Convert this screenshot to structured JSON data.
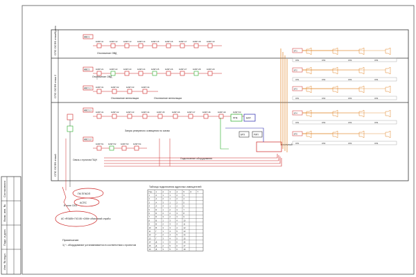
{
  "diagram": {
    "rows": [
      {
        "label": "СПС ОСФ5 этаж/Кухня"
      },
      {
        "label": "СПС ОСФ5 этаж 2"
      },
      {
        "label": "СПС ОСФ5 этаж1"
      }
    ],
    "panels": [
      "АВС1",
      "АВС1",
      "АВС1.1",
      "АВС1.1",
      "АВС1.2"
    ],
    "chain_row1": [
      "1МКП 11",
      "1МКП 12",
      "1МКП 13",
      "1МКП 14",
      "1МКП 15",
      "1МКП 16",
      "1МКП 17",
      "1МКП 18",
      "1МКП 19"
    ],
    "chain_row2": [
      "1МКП 21",
      "1МКП 22",
      "1МКП 23",
      "1МКП 24",
      "1МКП 25",
      "1МКП 26",
      "1МКП 27",
      "1МКП 28",
      "1МКП 29"
    ],
    "chain_row2b": [
      "1МКП 31",
      "1МКП 32",
      "1МКП 33",
      "1МКП 34"
    ],
    "chain_row3": [
      "1МКП 41",
      "1МКП 42",
      "1МКП 43",
      "1МКП 44",
      "1МКП 45",
      "1МКП 46",
      "1МКП 47",
      "1МКП 48",
      "1МКП 49",
      "1МКП 50"
    ],
    "chain_row3b": [
      "1МКП 51",
      "1МКП 52",
      "1МКП 53",
      "1МКП 54"
    ],
    "notes": {
      "n1": "Отключение ОВД",
      "n2": "Отключение ОВД",
      "n3": "Отключение вентиляции",
      "n4": "Отключение вентиляции",
      "n5": "Запуск резервного освещения по зонам",
      "n6": "Подключение оборудования",
      "n7": "Связь с пультом ПЦН",
      "n8": "Прибор приёмно-контрольный",
      "n9": "АС «RS485» ГКО-55 «СКМ» объектовой службы"
    },
    "speaker_groups": [
      "ЗП1",
      "ЗП2",
      "ЗП3",
      "ЗП4",
      "ЗП5",
      "ЗП6",
      "ЗП7",
      "ЗП8"
    ],
    "speaker_labels": [
      "ОП1",
      "ОП2",
      "ОП3",
      "ОП4"
    ],
    "devices": [
      "ППК",
      "БИЛ",
      "БРЗ",
      "РИП"
    ],
    "outside": {
      "pc_label": "ПК ППКОП",
      "ac_label": "АСПС",
      "zone": "В зоне ОЛЗ"
    },
    "notes_block": {
      "title": "Примечание:",
      "line1": "1) *- оборудование устанавливается в соответствии с проектом"
    },
    "table": {
      "title": "Таблица подключения адресных извещателей",
      "columns": [
        "Поз.",
        "1",
        "2",
        "3",
        "4",
        "5",
        "6",
        "7"
      ],
      "rows": [
        [
          "1",
          "А",
          "1",
          "1",
          "2",
          "3",
          "",
          ""
        ],
        [
          "2",
          "А",
          "2",
          "1",
          "2",
          "4",
          "",
          ""
        ],
        [
          "3",
          "А",
          "3",
          "1",
          "2",
          "5",
          "",
          ""
        ],
        [
          "4",
          "А",
          "4",
          "1",
          "2",
          "6",
          "",
          ""
        ],
        [
          "5",
          "Б",
          "1",
          "2",
          "3",
          "7",
          "",
          ""
        ],
        [
          "6",
          "Б",
          "2",
          "2",
          "3",
          "8",
          "",
          ""
        ],
        [
          "7",
          "Б",
          "3",
          "2",
          "3",
          "9",
          "",
          ""
        ],
        [
          "8",
          "В",
          "1",
          "3",
          "4",
          "10",
          "",
          ""
        ],
        [
          "9",
          "В",
          "2",
          "3",
          "4",
          "11",
          "",
          ""
        ],
        [
          "10",
          "В",
          "3",
          "3",
          "4",
          "12",
          "",
          ""
        ],
        [
          "11",
          "Г",
          "1",
          "4",
          "5",
          "13",
          "",
          ""
        ],
        [
          "12",
          "Г",
          "2",
          "4",
          "5",
          "14",
          "",
          ""
        ],
        [
          "13",
          "Г",
          "3",
          "4",
          "5",
          "15",
          "",
          ""
        ],
        [
          "14",
          "Д",
          "1",
          "5",
          "6",
          "16",
          "",
          ""
        ],
        [
          "15",
          "Д",
          "2",
          "5",
          "6",
          "17",
          "",
          ""
        ],
        [
          "16",
          "Д",
          "3",
          "5",
          "6",
          "18",
          "",
          ""
        ]
      ]
    },
    "stamp_cells": [
      "Инв. № подл.",
      "Подп. и дата",
      "Взам. инв. №",
      "Согласовано"
    ]
  }
}
